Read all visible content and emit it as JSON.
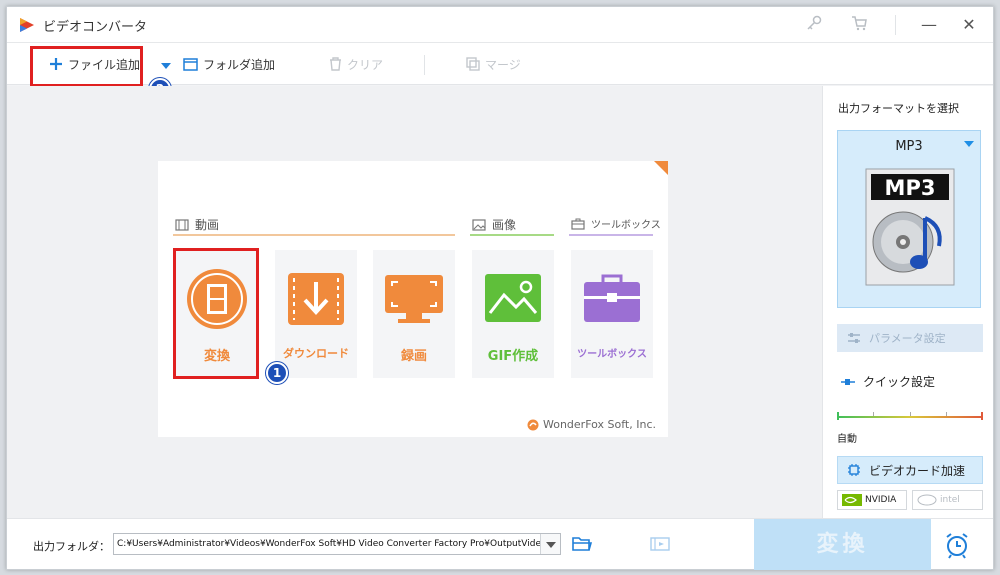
{
  "app": {
    "title": "ビデオコンバータ"
  },
  "toolbar": {
    "add_file": "ファイル追加",
    "add_folder": "フォルダ追加",
    "clear": "クリア",
    "merge": "マージ"
  },
  "steps": {
    "one": "1",
    "two": "2"
  },
  "categories": {
    "video": "動画",
    "image": "画像",
    "toolbox": "ツールボックス"
  },
  "tiles": [
    {
      "label": "変換",
      "color": "#f08a3c"
    },
    {
      "label": "ダウンロード",
      "color": "#f08a3c"
    },
    {
      "label": "録画",
      "color": "#f08a3c"
    },
    {
      "label": "GIF作成",
      "color": "#5fbf3a"
    },
    {
      "label": "ツールボックス",
      "color": "#9b6fd3"
    }
  ],
  "brand": "WonderFox Soft, Inc.",
  "right_panel": {
    "title": "出力フォーマットを選択",
    "format": "MP3",
    "format_image_text": "MP3",
    "params": "パラメータ設定",
    "quick": "クイック設定",
    "quick_level": "自動",
    "gpu": "ビデオカード加速",
    "nvidia": "NVIDIA",
    "intel": "intel"
  },
  "bottom": {
    "output_label": "出力フォルダ：",
    "output_path": "C:¥Users¥Administrator¥Videos¥WonderFox Soft¥HD Video Converter Factory Pro¥OutputVideo¥",
    "convert": "変換"
  }
}
